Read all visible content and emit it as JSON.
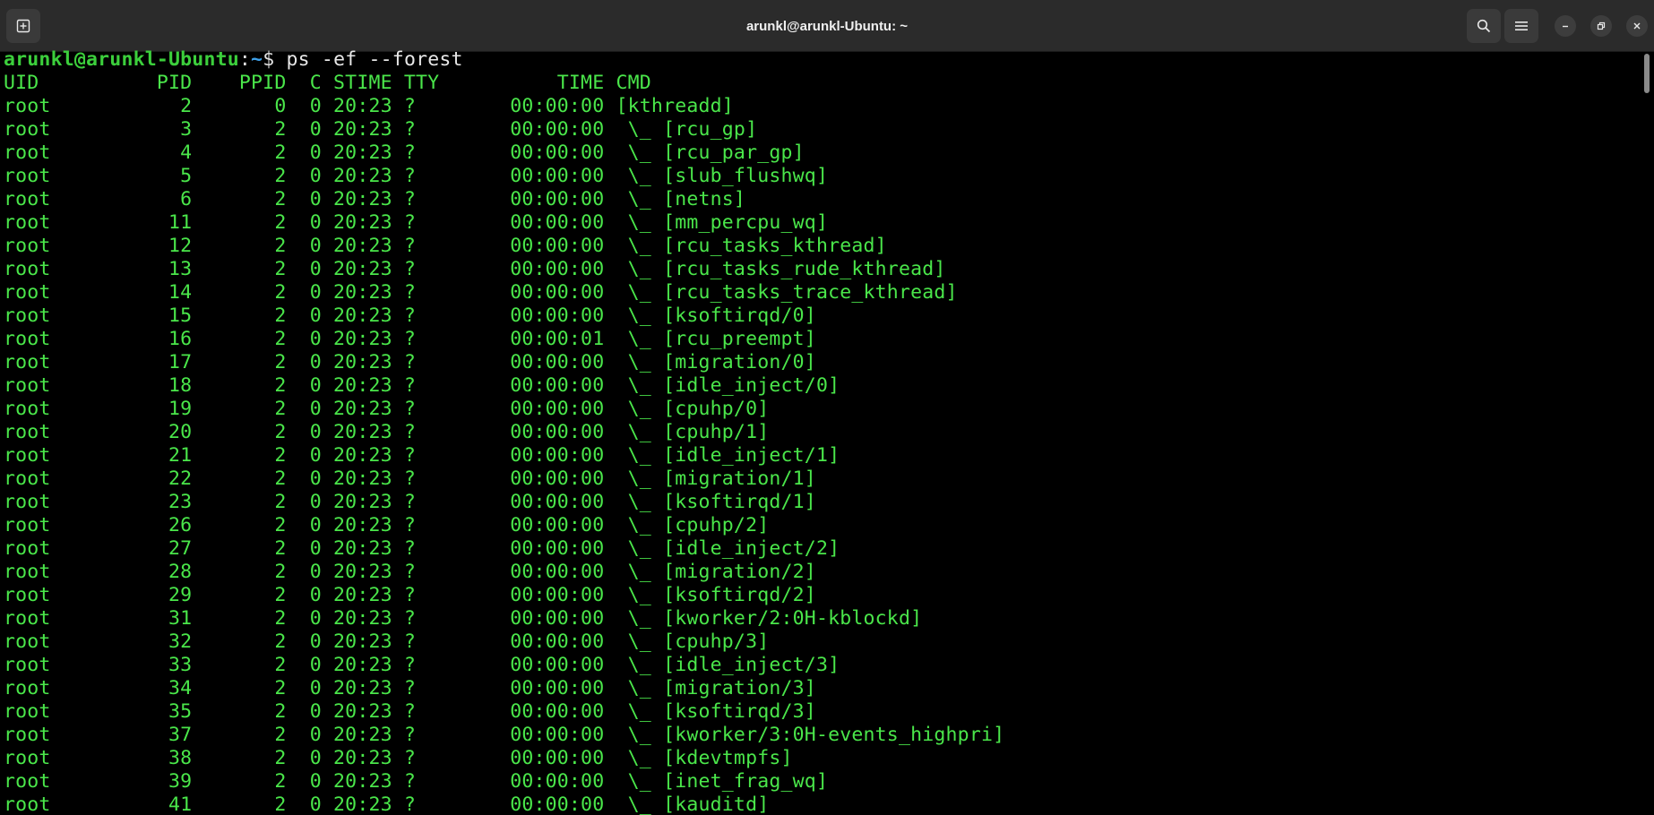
{
  "window": {
    "title": "arunkl@arunkl-Ubuntu: ~"
  },
  "icons": {
    "new_tab": "new-tab-icon",
    "search": "search-icon",
    "menu": "hamburger-menu-icon",
    "minimize": "minimize-icon",
    "restore": "restore-icon",
    "close": "close-icon"
  },
  "prompt": {
    "user_host": "arunkl@arunkl-Ubuntu",
    "separator": ":",
    "path": "~",
    "symbol": "$ ",
    "command": "ps -ef --forest"
  },
  "output": {
    "header": "UID          PID    PPID  C STIME TTY          TIME CMD",
    "rows": [
      "root           2       0  0 20:23 ?        00:00:00 [kthreadd]",
      "root           3       2  0 20:23 ?        00:00:00  \\_ [rcu_gp]",
      "root           4       2  0 20:23 ?        00:00:00  \\_ [rcu_par_gp]",
      "root           5       2  0 20:23 ?        00:00:00  \\_ [slub_flushwq]",
      "root           6       2  0 20:23 ?        00:00:00  \\_ [netns]",
      "root          11       2  0 20:23 ?        00:00:00  \\_ [mm_percpu_wq]",
      "root          12       2  0 20:23 ?        00:00:00  \\_ [rcu_tasks_kthread]",
      "root          13       2  0 20:23 ?        00:00:00  \\_ [rcu_tasks_rude_kthread]",
      "root          14       2  0 20:23 ?        00:00:00  \\_ [rcu_tasks_trace_kthread]",
      "root          15       2  0 20:23 ?        00:00:00  \\_ [ksoftirqd/0]",
      "root          16       2  0 20:23 ?        00:00:01  \\_ [rcu_preempt]",
      "root          17       2  0 20:23 ?        00:00:00  \\_ [migration/0]",
      "root          18       2  0 20:23 ?        00:00:00  \\_ [idle_inject/0]",
      "root          19       2  0 20:23 ?        00:00:00  \\_ [cpuhp/0]",
      "root          20       2  0 20:23 ?        00:00:00  \\_ [cpuhp/1]",
      "root          21       2  0 20:23 ?        00:00:00  \\_ [idle_inject/1]",
      "root          22       2  0 20:23 ?        00:00:00  \\_ [migration/1]",
      "root          23       2  0 20:23 ?        00:00:00  \\_ [ksoftirqd/1]",
      "root          26       2  0 20:23 ?        00:00:00  \\_ [cpuhp/2]",
      "root          27       2  0 20:23 ?        00:00:00  \\_ [idle_inject/2]",
      "root          28       2  0 20:23 ?        00:00:00  \\_ [migration/2]",
      "root          29       2  0 20:23 ?        00:00:00  \\_ [ksoftirqd/2]",
      "root          31       2  0 20:23 ?        00:00:00  \\_ [kworker/2:0H-kblockd]",
      "root          32       2  0 20:23 ?        00:00:00  \\_ [cpuhp/3]",
      "root          33       2  0 20:23 ?        00:00:00  \\_ [idle_inject/3]",
      "root          34       2  0 20:23 ?        00:00:00  \\_ [migration/3]",
      "root          35       2  0 20:23 ?        00:00:00  \\_ [ksoftirqd/3]",
      "root          37       2  0 20:23 ?        00:00:00  \\_ [kworker/3:0H-events_highpri]",
      "root          38       2  0 20:23 ?        00:00:00  \\_ [kdevtmpfs]",
      "root          39       2  0 20:23 ?        00:00:00  \\_ [inet_frag_wq]",
      "root          41       2  0 20:23 ?        00:00:00  \\_ [kauditd]"
    ]
  },
  "colors": {
    "background": "#000000",
    "output_text": "#4ae64a",
    "prompt_user": "#3ccf3c",
    "prompt_path": "#3ea0e8",
    "titlebar": "#2b2b2b"
  }
}
